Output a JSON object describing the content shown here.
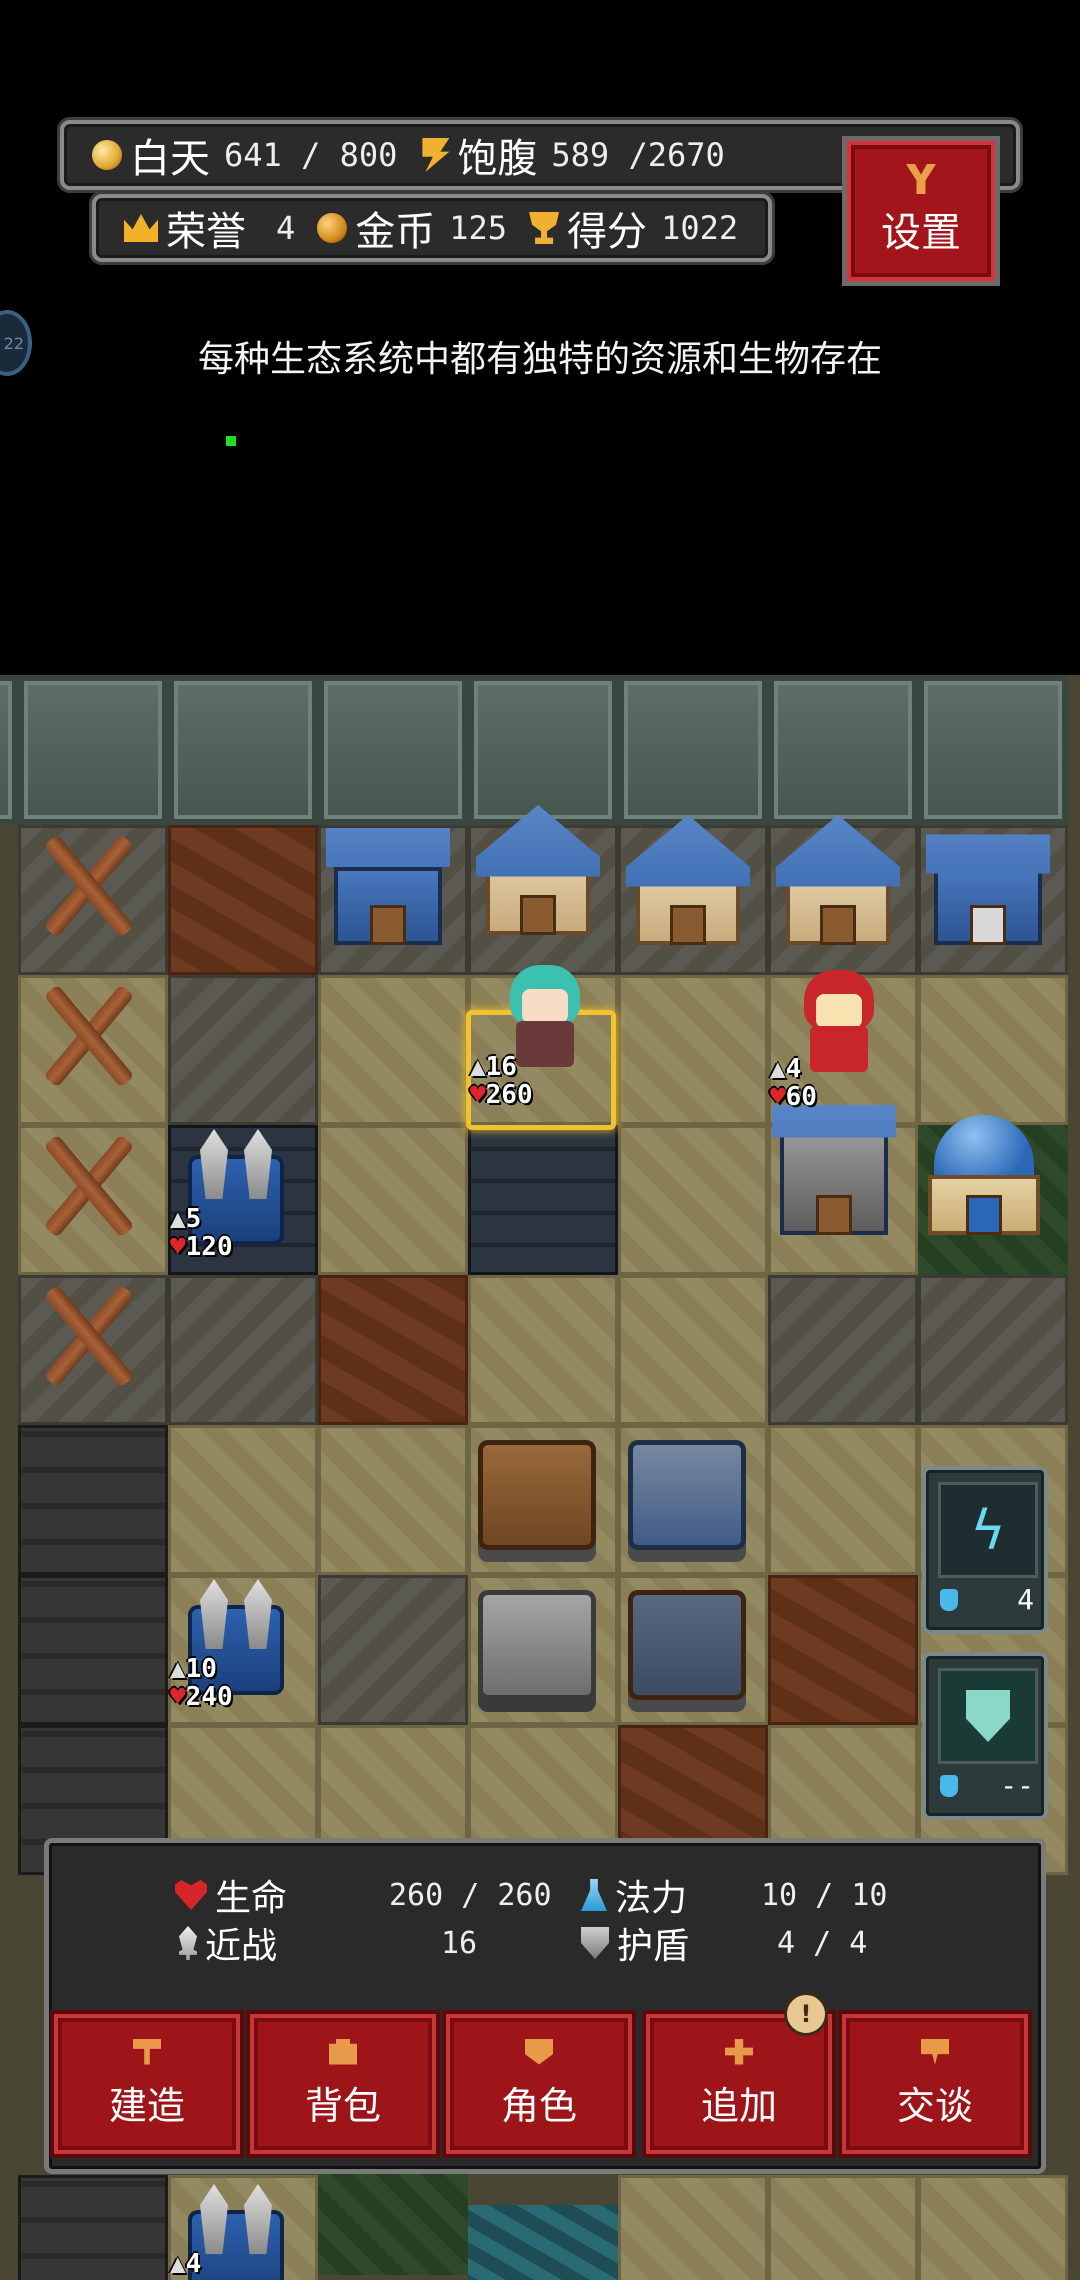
{
  "hud": {
    "day": {
      "label": "白天",
      "current": "641",
      "max": "800"
    },
    "satiety": {
      "label": "饱腹",
      "current": "589",
      "max": "2670"
    },
    "honor": {
      "label": "荣誉",
      "value": "4"
    },
    "gold": {
      "label": "金币",
      "value": "125"
    },
    "score": {
      "label": "得分",
      "value": "1022"
    },
    "settings_label": "设置"
  },
  "tip": "每种生态系统中都有独特的资源和生物存在",
  "side_bubble_text": "22",
  "units": {
    "hero": {
      "attack": "16",
      "hp": "260"
    },
    "redhood": {
      "attack": "4",
      "hp": "60"
    },
    "ballista_a": {
      "attack": "5",
      "hp": "120"
    },
    "ballista_b": {
      "attack": "10",
      "hp": "240"
    },
    "ballista_c": {
      "attack": "4"
    }
  },
  "cards": [
    {
      "icon": "lightning-rune-icon",
      "cost": "4"
    },
    {
      "icon": "shield-rune-icon",
      "cost": "--"
    }
  ],
  "stats": {
    "hp": {
      "label": "生命",
      "current": "260",
      "max": "260"
    },
    "mana": {
      "label": "法力",
      "current": "10",
      "max": "10"
    },
    "melee": {
      "label": "近战",
      "value": "16"
    },
    "shield": {
      "label": "护盾",
      "current": "4",
      "max": "4"
    }
  },
  "actions": [
    {
      "label": "建造",
      "icon": "hammer-icon"
    },
    {
      "label": "背包",
      "icon": "bag-icon"
    },
    {
      "label": "角色",
      "icon": "person-icon"
    },
    {
      "label": "追加",
      "icon": "plus-icon",
      "badge": "!"
    },
    {
      "label": "交谈",
      "icon": "chat-icon"
    }
  ],
  "colors": {
    "accent_red": "#9e1519",
    "select_gold": "#f2c230",
    "hp_red": "#d8252a",
    "mana_blue": "#2a9ad8"
  }
}
